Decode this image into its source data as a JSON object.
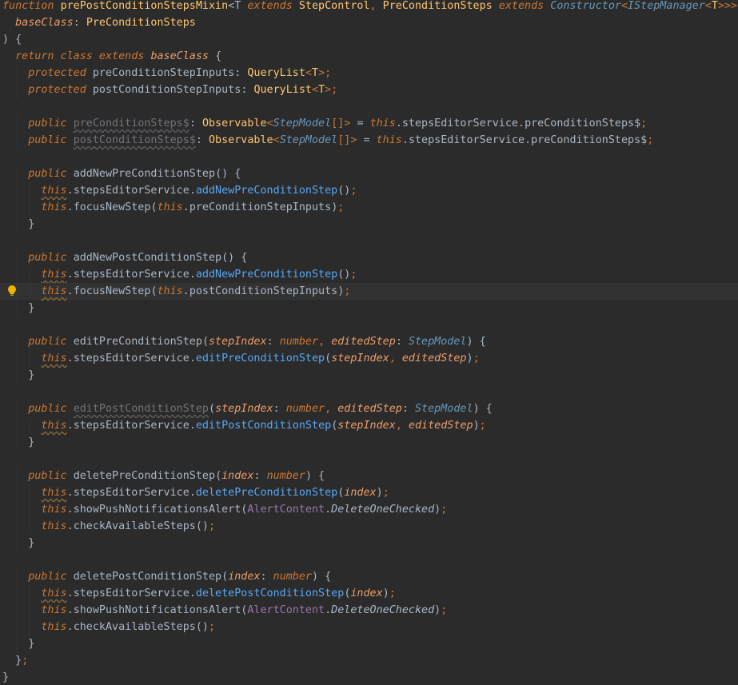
{
  "editor": {
    "lines": [
      [
        [
          "kw",
          "function "
        ],
        [
          "fn",
          "prePostConditionStepsMixin"
        ],
        [
          "punc",
          "<T "
        ],
        [
          "kw",
          "extends "
        ],
        [
          "ty",
          "StepControl"
        ],
        [
          "sep",
          ", "
        ],
        [
          "ty",
          "PreConditionSteps "
        ],
        [
          "kw",
          "extends "
        ],
        [
          "tyi",
          "Constructor"
        ],
        [
          "ang",
          "<"
        ],
        [
          "tyi",
          "IStepManager"
        ],
        [
          "ang",
          "<"
        ],
        [
          "gen",
          "T"
        ],
        [
          "ang",
          ">>>"
        ],
        [
          "punc",
          "("
        ]
      ],
      [
        [
          "punc",
          "  "
        ],
        [
          "prm",
          "baseClass"
        ],
        [
          "punc",
          ": "
        ],
        [
          "ty",
          "PreConditionSteps"
        ]
      ],
      [
        [
          "punc",
          ") {"
        ]
      ],
      [
        [
          "punc",
          "  "
        ],
        [
          "kw",
          "return class extends "
        ],
        [
          "prm",
          "baseClass "
        ],
        [
          "punc",
          "{"
        ]
      ],
      [
        [
          "punc",
          "    "
        ],
        [
          "kw",
          "protected "
        ],
        [
          "pr",
          "preConditionStepInputs"
        ],
        [
          "punc",
          ": "
        ],
        [
          "ty",
          "QueryList"
        ],
        [
          "ang",
          "<"
        ],
        [
          "gen",
          "T"
        ],
        [
          "ang",
          ">"
        ],
        [
          "sep",
          ";"
        ]
      ],
      [
        [
          "punc",
          "    "
        ],
        [
          "kw",
          "protected "
        ],
        [
          "pr",
          "postConditionStepInputs"
        ],
        [
          "punc",
          ": "
        ],
        [
          "ty",
          "QueryList"
        ],
        [
          "ang",
          "<"
        ],
        [
          "gen",
          "T"
        ],
        [
          "ang",
          ">"
        ],
        [
          "sep",
          ";"
        ]
      ],
      [],
      [
        [
          "punc",
          "    "
        ],
        [
          "kw",
          "public "
        ],
        [
          "unused",
          "preConditionSteps$"
        ],
        [
          "punc",
          ": "
        ],
        [
          "ty",
          "Observable"
        ],
        [
          "ang",
          "<"
        ],
        [
          "tyi",
          "StepModel"
        ],
        [
          "brk",
          "[]"
        ],
        [
          "ang",
          "> "
        ],
        [
          "punc",
          "= "
        ],
        [
          "thisk",
          "this"
        ],
        [
          "punc",
          "."
        ],
        [
          "pr",
          "stepsEditorService"
        ],
        [
          "punc",
          "."
        ],
        [
          "pr",
          "preConditionSteps$"
        ],
        [
          "sep",
          ";"
        ]
      ],
      [
        [
          "punc",
          "    "
        ],
        [
          "kw",
          "public "
        ],
        [
          "unused",
          "postConditionSteps$"
        ],
        [
          "punc",
          ": "
        ],
        [
          "ty",
          "Observable"
        ],
        [
          "ang",
          "<"
        ],
        [
          "tyi",
          "StepModel"
        ],
        [
          "brk",
          "[]"
        ],
        [
          "ang",
          "> "
        ],
        [
          "punc",
          "= "
        ],
        [
          "thisk",
          "this"
        ],
        [
          "punc",
          "."
        ],
        [
          "pr",
          "stepsEditorService"
        ],
        [
          "punc",
          "."
        ],
        [
          "pr",
          "preConditionSteps$"
        ],
        [
          "sep",
          ";"
        ]
      ],
      [],
      [
        [
          "punc",
          "    "
        ],
        [
          "kw",
          "public "
        ],
        [
          "pr",
          "addNewPreConditionStep"
        ],
        [
          "punc",
          "() {"
        ]
      ],
      [
        [
          "punc",
          "      "
        ],
        [
          "thisw",
          "this"
        ],
        [
          "punc",
          "."
        ],
        [
          "pr",
          "stepsEditorService"
        ],
        [
          "punc",
          "."
        ],
        [
          "mth",
          "addNewPreConditionStep"
        ],
        [
          "punc",
          "()"
        ],
        [
          "sep",
          ";"
        ]
      ],
      [
        [
          "punc",
          "      "
        ],
        [
          "thisk",
          "this"
        ],
        [
          "punc",
          "."
        ],
        [
          "pr",
          "focusNewStep"
        ],
        [
          "punc",
          "("
        ],
        [
          "thisk",
          "this"
        ],
        [
          "punc",
          "."
        ],
        [
          "pr",
          "preConditionStepInputs"
        ],
        [
          "punc",
          ")"
        ],
        [
          "sep",
          ";"
        ]
      ],
      [
        [
          "punc",
          "    }"
        ]
      ],
      [],
      [
        [
          "punc",
          "    "
        ],
        [
          "kw",
          "public "
        ],
        [
          "pr",
          "addNewPostConditionStep"
        ],
        [
          "punc",
          "() {"
        ]
      ],
      [
        [
          "punc",
          "      "
        ],
        [
          "thisw",
          "this"
        ],
        [
          "punc",
          "."
        ],
        [
          "pr",
          "stepsEditorService"
        ],
        [
          "punc",
          "."
        ],
        [
          "mth",
          "addNewPreConditionStep"
        ],
        [
          "punc",
          "()"
        ],
        [
          "sep",
          ";"
        ]
      ],
      [
        [
          "punc",
          "      "
        ],
        [
          "thisw",
          "this"
        ],
        [
          "punc",
          "."
        ],
        [
          "pr",
          "focusNewStep"
        ],
        [
          "punc",
          "("
        ],
        [
          "thisk",
          "this"
        ],
        [
          "punc",
          "."
        ],
        [
          "pr",
          "postConditionStepInputs"
        ],
        [
          "punc",
          ")"
        ],
        [
          "sep",
          ";"
        ]
      ],
      [
        [
          "punc",
          "    }"
        ]
      ],
      [],
      [
        [
          "punc",
          "    "
        ],
        [
          "kw",
          "public "
        ],
        [
          "pr",
          "editPreConditionStep"
        ],
        [
          "punc",
          "("
        ],
        [
          "prm",
          "stepIndex"
        ],
        [
          "punc",
          ": "
        ],
        [
          "kw",
          "number"
        ],
        [
          "sep",
          ", "
        ],
        [
          "prm",
          "editedStep"
        ],
        [
          "punc",
          ": "
        ],
        [
          "tyi",
          "StepModel"
        ],
        [
          "punc",
          ") {"
        ]
      ],
      [
        [
          "punc",
          "      "
        ],
        [
          "thisw",
          "this"
        ],
        [
          "punc",
          "."
        ],
        [
          "pr",
          "stepsEditorService"
        ],
        [
          "punc",
          "."
        ],
        [
          "mth",
          "editPreConditionStep"
        ],
        [
          "punc",
          "("
        ],
        [
          "prm",
          "stepIndex"
        ],
        [
          "sep",
          ", "
        ],
        [
          "prm",
          "editedStep"
        ],
        [
          "punc",
          ")"
        ],
        [
          "sep",
          ";"
        ]
      ],
      [
        [
          "punc",
          "    }"
        ]
      ],
      [],
      [
        [
          "punc",
          "    "
        ],
        [
          "kw",
          "public "
        ],
        [
          "unused",
          "editPostConditionStep"
        ],
        [
          "punc",
          "("
        ],
        [
          "prm",
          "stepIndex"
        ],
        [
          "punc",
          ": "
        ],
        [
          "kw",
          "number"
        ],
        [
          "sep",
          ", "
        ],
        [
          "prm",
          "editedStep"
        ],
        [
          "punc",
          ": "
        ],
        [
          "tyi",
          "StepModel"
        ],
        [
          "punc",
          ") {"
        ]
      ],
      [
        [
          "punc",
          "      "
        ],
        [
          "thisw",
          "this"
        ],
        [
          "punc",
          "."
        ],
        [
          "pr",
          "stepsEditorService"
        ],
        [
          "punc",
          "."
        ],
        [
          "mth",
          "editPostConditionStep"
        ],
        [
          "punc",
          "("
        ],
        [
          "prm",
          "stepIndex"
        ],
        [
          "sep",
          ", "
        ],
        [
          "prm",
          "editedStep"
        ],
        [
          "punc",
          ")"
        ],
        [
          "sep",
          ";"
        ]
      ],
      [
        [
          "punc",
          "    }"
        ]
      ],
      [],
      [
        [
          "punc",
          "    "
        ],
        [
          "kw",
          "public "
        ],
        [
          "pr",
          "deletePreConditionStep"
        ],
        [
          "punc",
          "("
        ],
        [
          "prm",
          "index"
        ],
        [
          "punc",
          ": "
        ],
        [
          "kw",
          "number"
        ],
        [
          "punc",
          ") {"
        ]
      ],
      [
        [
          "punc",
          "      "
        ],
        [
          "thisw",
          "this"
        ],
        [
          "punc",
          "."
        ],
        [
          "pr",
          "stepsEditorService"
        ],
        [
          "punc",
          "."
        ],
        [
          "mth",
          "deletePreConditionStep"
        ],
        [
          "punc",
          "("
        ],
        [
          "prm",
          "index"
        ],
        [
          "punc",
          ")"
        ],
        [
          "sep",
          ";"
        ]
      ],
      [
        [
          "punc",
          "      "
        ],
        [
          "thisk",
          "this"
        ],
        [
          "punc",
          "."
        ],
        [
          "pr",
          "showPushNotificationsAlert"
        ],
        [
          "punc",
          "("
        ],
        [
          "enum",
          "AlertContent"
        ],
        [
          "punc",
          "."
        ],
        [
          "enumm",
          "DeleteOneChecked"
        ],
        [
          "punc",
          ")"
        ],
        [
          "sep",
          ";"
        ]
      ],
      [
        [
          "punc",
          "      "
        ],
        [
          "thisk",
          "this"
        ],
        [
          "punc",
          "."
        ],
        [
          "pr",
          "checkAvailableSteps"
        ],
        [
          "punc",
          "()"
        ],
        [
          "sep",
          ";"
        ]
      ],
      [
        [
          "punc",
          "    }"
        ]
      ],
      [],
      [
        [
          "punc",
          "    "
        ],
        [
          "kw",
          "public "
        ],
        [
          "pr",
          "deletePostConditionStep"
        ],
        [
          "punc",
          "("
        ],
        [
          "prm",
          "index"
        ],
        [
          "punc",
          ": "
        ],
        [
          "kw",
          "number"
        ],
        [
          "punc",
          ") {"
        ]
      ],
      [
        [
          "punc",
          "      "
        ],
        [
          "thisw",
          "this"
        ],
        [
          "punc",
          "."
        ],
        [
          "pr",
          "stepsEditorService"
        ],
        [
          "punc",
          "."
        ],
        [
          "mth",
          "deletePostConditionStep"
        ],
        [
          "punc",
          "("
        ],
        [
          "prm",
          "index"
        ],
        [
          "punc",
          ")"
        ],
        [
          "sep",
          ";"
        ]
      ],
      [
        [
          "punc",
          "      "
        ],
        [
          "thisk",
          "this"
        ],
        [
          "punc",
          "."
        ],
        [
          "pr",
          "showPushNotificationsAlert"
        ],
        [
          "punc",
          "("
        ],
        [
          "enum",
          "AlertContent"
        ],
        [
          "punc",
          "."
        ],
        [
          "enumm",
          "DeleteOneChecked"
        ],
        [
          "punc",
          ")"
        ],
        [
          "sep",
          ";"
        ]
      ],
      [
        [
          "punc",
          "      "
        ],
        [
          "thisk",
          "this"
        ],
        [
          "punc",
          "."
        ],
        [
          "pr",
          "checkAvailableSteps"
        ],
        [
          "punc",
          "()"
        ],
        [
          "sep",
          ";"
        ]
      ],
      [
        [
          "punc",
          "    }"
        ]
      ],
      [
        [
          "punc",
          "  }"
        ],
        [
          "sep",
          ";"
        ]
      ],
      [
        [
          "punc",
          "}"
        ]
      ]
    ],
    "current_line": 17,
    "bulb_line": 17,
    "icons": {
      "bulb": "lightbulb-icon"
    },
    "colors": {
      "background": "#2b2b2b",
      "current_line": "#323232",
      "keyword": "#cc7832",
      "function": "#ffc66d",
      "text": "#a9b7c6",
      "parameter": "#ee9d6a",
      "method_call": "#56a8f5",
      "interface_type": "#6897bb",
      "enum": "#9876aa",
      "unused": "#72737a"
    }
  }
}
